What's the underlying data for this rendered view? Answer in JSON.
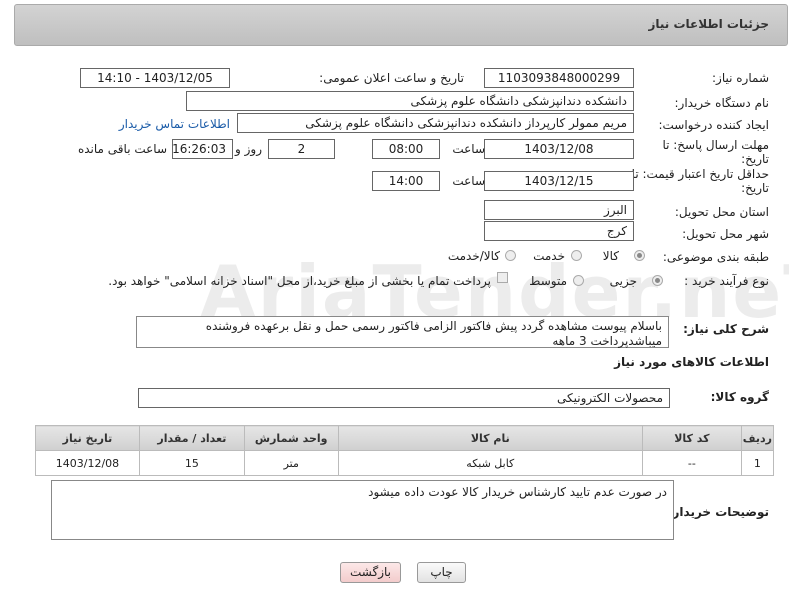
{
  "header": {
    "title": "جزئیات اطلاعات نیاز"
  },
  "fields": {
    "need_number_label": "شماره نیاز:",
    "need_number": "1103093848000299",
    "announce_label": "تاریخ و ساعت اعلان عمومی:",
    "announce_value": "1403/12/05 - 14:10",
    "buyer_org_label": "نام دستگاه خریدار:",
    "buyer_org": "دانشکده دندانپزشکی دانشگاه علوم پزشکی",
    "requester_label": "ایجاد کننده درخواست:",
    "requester": "مریم ممولر کارپرداز دانشکده دندانپزشکی دانشگاه علوم پزشکی",
    "contact_link": "اطلاعات تماس خریدار",
    "deadline_label_1": "مهلت ارسال پاسخ: تا",
    "deadline_label_2": "تاریخ:",
    "deadline_date": "1403/12/08",
    "time_label": "ساعت",
    "deadline_time": "08:00",
    "days_value": "2",
    "days_label": "روز و",
    "remaining_time": "16:26:03",
    "remaining_label": "ساعت باقی مانده",
    "validity_label_1": "حداقل تاریخ اعتبار قیمت: تا",
    "validity_label_2": "تاریخ:",
    "validity_date": "1403/12/15",
    "validity_time": "14:00",
    "province_label": "استان محل تحویل:",
    "province": "البرز",
    "city_label": "شهر محل تحویل:",
    "city": "کرج",
    "category_label": "طبقه بندی موضوعی:",
    "category_options": [
      "کالا",
      "خدمت",
      "کالا/خدمت"
    ],
    "process_label": "نوع فرآیند خرید :",
    "process_options": [
      "جزیی",
      "متوسط"
    ],
    "payment_note": "پرداخت تمام یا بخشی از مبلغ خرید،از محل \"اسناد خزانه اسلامی\" خواهد بود."
  },
  "description": {
    "label": "شرح کلی نیاز:",
    "text": "باسلام پیوست مشاهده گردد پیش فاکتور الزامی فاکتور رسمی حمل و نقل  برعهده فروشنده میباشدپرداخت 3 ماهه"
  },
  "goods": {
    "section_title": "اطلاعات کالاهای مورد نیاز",
    "group_label": "گروه کالا:",
    "group_value": "محصولات الکترونیکی",
    "columns": [
      "ردیف",
      "کد کالا",
      "نام کالا",
      "واحد شمارش",
      "تعداد / مقدار",
      "تاریخ نیاز"
    ],
    "rows": [
      [
        "1",
        "--",
        "کابل شبکه",
        "متر",
        "15",
        "1403/12/08"
      ]
    ]
  },
  "buyer_notes": {
    "label": "توضیحات خریدار:",
    "text": "در صورت عدم تایید کارشناس خریدار کالا عودت داده میشود"
  },
  "buttons": {
    "print": "چاپ",
    "back": "بازگشت"
  },
  "colors": {
    "link": "#1a5ba8",
    "back_button_bg": "#f7dada"
  }
}
